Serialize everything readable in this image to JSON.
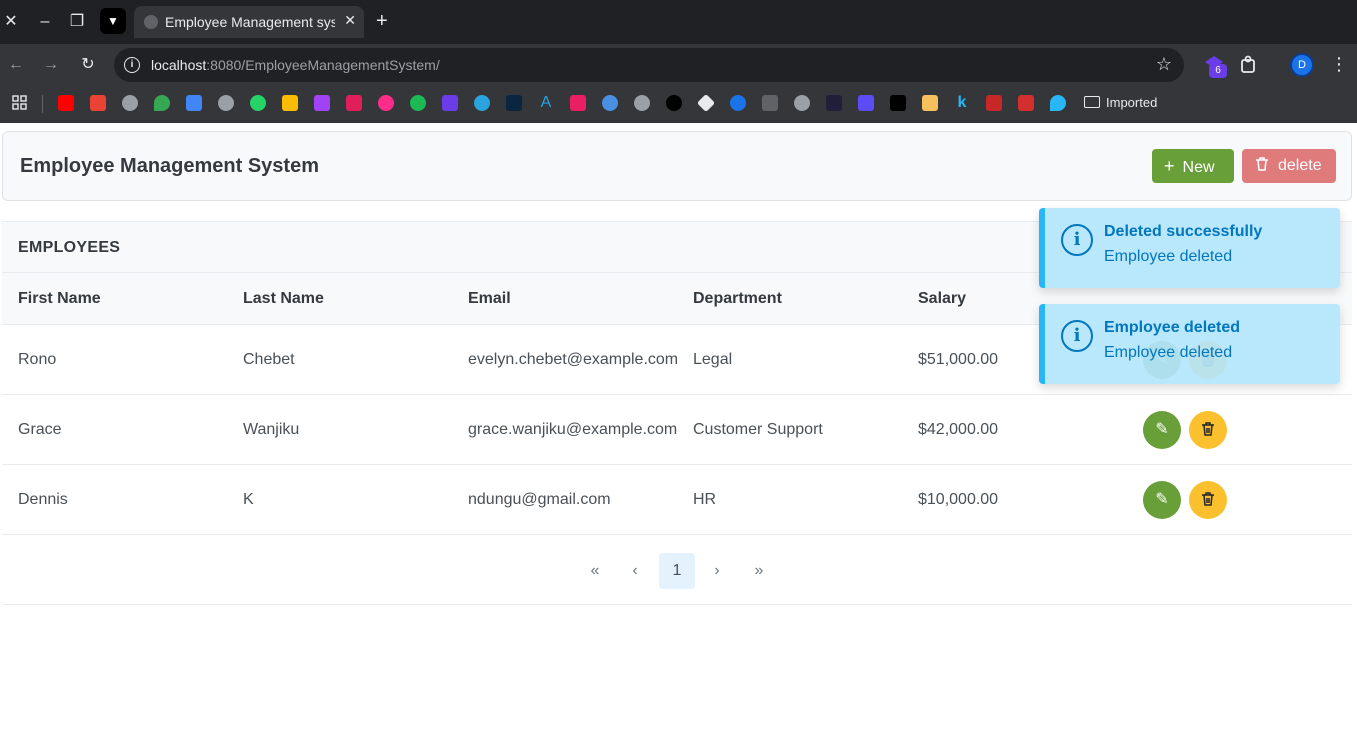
{
  "browser": {
    "tab_title": "Employee Management sys",
    "url_host": "localhost",
    "url_path": ":8080/EmployeeManagementSystem/",
    "profile_initial": "D",
    "extension_badge": "6",
    "bookmarks_folder": "Imported"
  },
  "app": {
    "title": "Employee Management System",
    "new_label": "New",
    "delete_label": "delete",
    "colors": {
      "success": "#689f38",
      "danger": "#e07b7b",
      "warning": "#fbc02d",
      "info": "#29b6f6"
    }
  },
  "table": {
    "caption": "EMPLOYEES",
    "headers": [
      "First Name",
      "Last Name",
      "Email",
      "Department",
      "Salary"
    ],
    "rows": [
      [
        "Rono",
        "Chebet",
        "evelyn.chebet@example.com",
        "Legal",
        "$51,000.00"
      ],
      [
        "Grace",
        "Wanjiku",
        "grace.wanjiku@example.com",
        "Customer Support",
        "$42,000.00"
      ],
      [
        "Dennis",
        "K",
        "ndungu@gmail.com",
        "HR",
        "$10,000.00"
      ]
    ]
  },
  "paginator": {
    "current_page": "1"
  },
  "toasts": [
    {
      "summary": "Deleted successfully",
      "detail": "Employee deleted"
    },
    {
      "summary": "Employee deleted",
      "detail": "Employee deleted"
    }
  ]
}
